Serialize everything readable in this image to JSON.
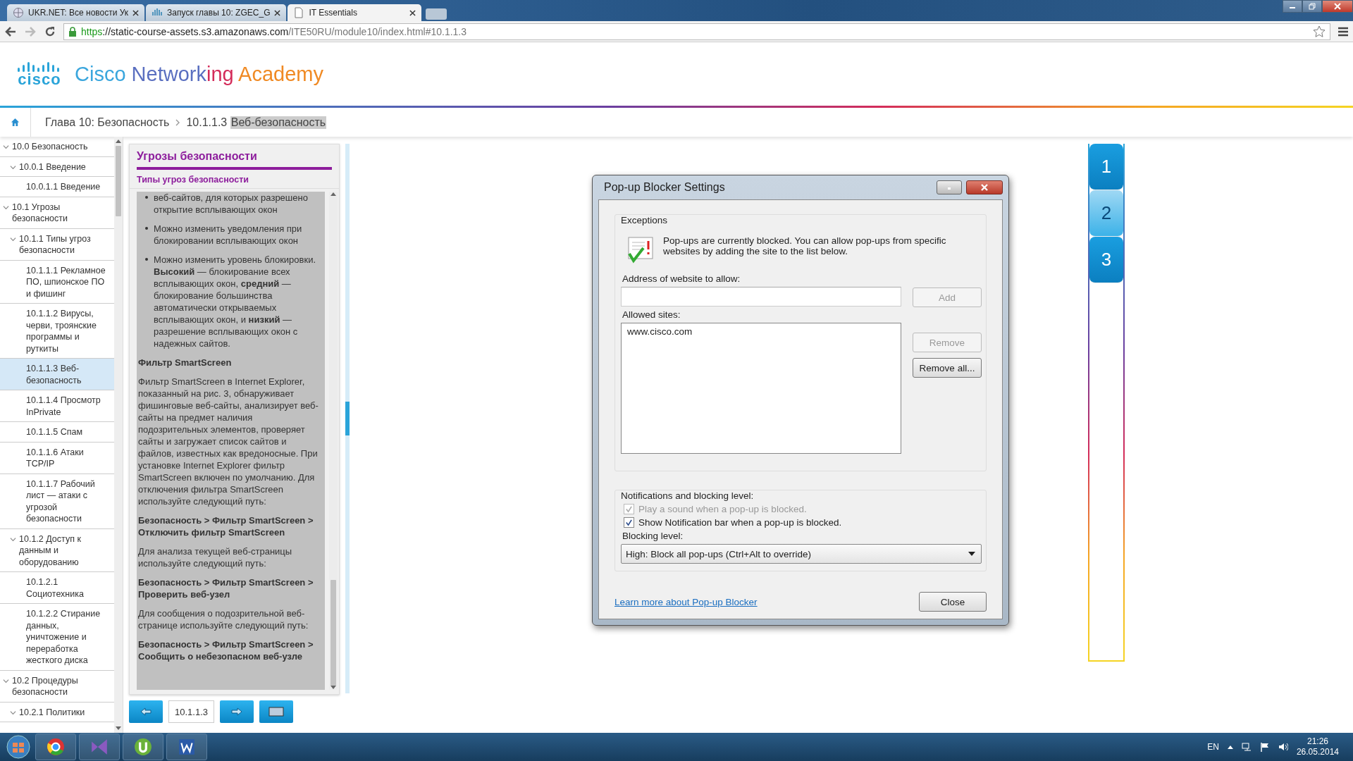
{
  "browser": {
    "tabs": [
      {
        "label": "UKR.NET: Все новости Ук",
        "selected": false
      },
      {
        "label": "Запуск главы 10: ZGEC_G",
        "selected": false
      },
      {
        "label": "IT Essentials",
        "selected": true
      }
    ],
    "address": {
      "scheme": "https",
      "host": "://static-course-assets.s3.amazonaws.com",
      "path": "/ITE50RU/module10/index.html#10.1.1.3"
    }
  },
  "header": {
    "logo": "cisco",
    "title": [
      {
        "text": "Cisco ",
        "color": "#3aa6dd"
      },
      {
        "text": "Network",
        "color": "#5a6fc0"
      },
      {
        "text": "ing ",
        "color": "#d42c5a"
      },
      {
        "text": "Academy",
        "color": "#f08a24"
      }
    ]
  },
  "breadcrumb": {
    "items": [
      "Глава 10: Безопасность",
      "10.1.1.3"
    ],
    "current": "Веб-безопасность"
  },
  "sidebar": {
    "items": [
      {
        "label": "10.0 Безопасность",
        "expanded": true,
        "selected": false,
        "children": [
          {
            "label": "10.0.1 Введение",
            "expanded": true,
            "selected": false,
            "children": [
              {
                "label": "10.0.1.1 Введение",
                "selected": false
              }
            ]
          }
        ]
      },
      {
        "label": "10.1 Угрозы безопасности",
        "expanded": true,
        "selected": false,
        "children": [
          {
            "label": "10.1.1 Типы угроз безопасности",
            "expanded": true,
            "selected": false,
            "children": [
              {
                "label": "10.1.1.1 Рекламное ПО, шпионское ПО и фишинг",
                "selected": false
              },
              {
                "label": "10.1.1.2 Вирусы, черви, троянские программы и руткиты",
                "selected": false
              },
              {
                "label": "10.1.1.3 Веб-безопасность",
                "selected": true
              },
              {
                "label": "10.1.1.4 Просмотр InPrivate",
                "selected": false
              },
              {
                "label": "10.1.1.5 Спам",
                "selected": false
              },
              {
                "label": "10.1.1.6 Атаки TCP/IP",
                "selected": false
              },
              {
                "label": "10.1.1.7 Рабочий лист — атаки с угрозой безопасности",
                "selected": false
              }
            ]
          },
          {
            "label": "10.1.2 Доступ к данным и оборудованию",
            "expanded": true,
            "selected": false,
            "children": [
              {
                "label": "10.1.2.1 Социотехника",
                "selected": false
              },
              {
                "label": "10.1.2.2 Стирание данных, уничтожение и переработка жесткого диска",
                "selected": false
              }
            ]
          }
        ]
      },
      {
        "label": "10.2 Процедуры безопасности",
        "expanded": true,
        "selected": false,
        "children": [
          {
            "label": "10.2.1 Политики",
            "expanded": true,
            "selected": false
          }
        ]
      }
    ]
  },
  "content": {
    "title": "Угрозы безопасности",
    "subtitle": "Типы угроз безопасности",
    "blocks": [
      {
        "kind": "bullet",
        "text": "веб-сайтов, для которых разрешено открытие всплывающих окон"
      },
      {
        "kind": "bullet",
        "text": "Можно изменить уведомления при блокировании всплывающих окон"
      },
      {
        "kind": "bullet",
        "text": "Можно изменить уровень блокировки. **Высокий** — блокирование всех всплывающих окон, **средний** — блокирование большинства автоматически открываемых всплывающих окон, и **низкий** — разрешение всплывающих окон с надежных сайтов."
      },
      {
        "kind": "heading",
        "text": "Фильтр SmartScreen"
      },
      {
        "kind": "paragraph",
        "text": "Фильтр SmartScreen в Internet Explorer, показанный на рис. 3, обнаруживает фишинговые веб-сайты, анализирует веб-сайты на предмет наличия подозрительных элементов, проверяет сайты и загружает список сайтов и файлов, известных как вредоносные. При установке Internet Explorer фильтр SmartScreen включен по умолчанию. Для отключения фильтра SmartScreen используйте следующий путь:"
      },
      {
        "kind": "path",
        "text": "Безопасность > Фильтр SmartScreen > Отключить фильтр SmartScreen"
      },
      {
        "kind": "paragraph",
        "text": "Для анализа текущей веб-страницы используйте следующий путь:"
      },
      {
        "kind": "path",
        "text": "Безопасность > Фильтр SmartScreen > Проверить веб-узел"
      },
      {
        "kind": "paragraph",
        "text": "Для сообщения о подозрительной веб-странице используйте следующий путь:"
      },
      {
        "kind": "path",
        "text": "Безопасность > Фильтр SmartScreen > Сообщить о небезопасном веб-узле"
      }
    ],
    "page": "10.1.1.3"
  },
  "dialog": {
    "title": "Pop-up Blocker Settings",
    "exceptions": {
      "legend": "Exceptions",
      "info": "Pop-ups are currently blocked.  You can allow pop-ups from specific websites by adding the site to the list below.",
      "address_label": "Address of website to allow:",
      "add": {
        "label": "Add",
        "disabled": true
      },
      "allowed_label": "Allowed sites:",
      "allowed_sites": [
        "www.cisco.com"
      ],
      "remove": {
        "label": "Remove",
        "disabled": true
      },
      "remove_all": {
        "label": "Remove all...",
        "disabled": false
      }
    },
    "notifications": {
      "legend": "Notifications and blocking level:",
      "options": [
        {
          "label": "Play a sound when a pop-up is blocked.",
          "checked": true,
          "disabled": true
        },
        {
          "label": "Show Notification bar when a pop-up is blocked.",
          "checked": true,
          "disabled": false
        }
      ],
      "level_label": "Blocking level:",
      "level_value": "High: Block all pop-ups (Ctrl+Alt to override)"
    },
    "link": "Learn more about Pop-up Blocker",
    "close": "Close"
  },
  "figures": [
    {
      "label": "1",
      "selected": false
    },
    {
      "label": "2",
      "selected": true
    },
    {
      "label": "3",
      "selected": false
    }
  ],
  "taskbar": {
    "language": "EN",
    "time": "21:26",
    "date": "26.05.2014"
  }
}
